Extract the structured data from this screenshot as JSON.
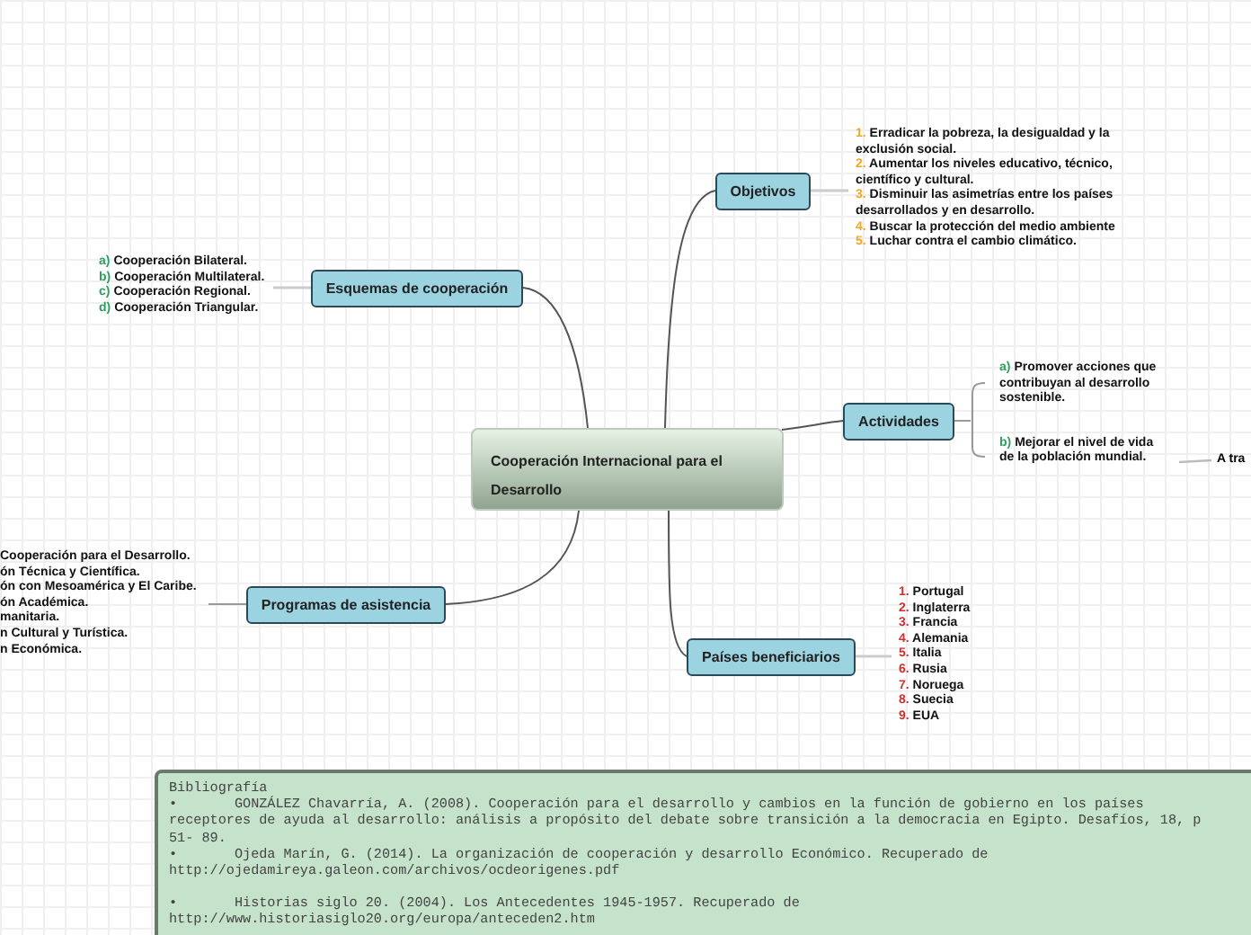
{
  "center": {
    "title": "Cooperación Internacional para el Desarrollo"
  },
  "branches": [
    {
      "label": "Objetivos",
      "color": "#f5a623",
      "items": [
        {
          "marker": "1.",
          "text": "Erradicar la pobreza, la desigualdad y la exclusión social."
        },
        {
          "marker": "2.",
          "text": "Aumentar los niveles educativo, técnico, científico y cultural."
        },
        {
          "marker": "3.",
          "text": "Disminuir las asimetrías entre los países desarrollados y en desarrollo."
        },
        {
          "marker": "4.",
          "text": "Buscar la protección del medio ambiente"
        },
        {
          "marker": "5.",
          "text": "Luchar contra el cambio climático."
        }
      ]
    },
    {
      "label": "Esquemas de cooperación",
      "color": "#2e9e5e",
      "items": [
        {
          "marker": "a)",
          "text": "Cooperación Bilateral."
        },
        {
          "marker": "b)",
          "text": "Cooperación Multilateral."
        },
        {
          "marker": "c)",
          "text": "Cooperación Regional."
        },
        {
          "marker": "d)",
          "text": "Cooperación Triangular."
        }
      ]
    },
    {
      "label": "Actividades",
      "color": "#2e9e5e",
      "items": [
        {
          "marker": "a)",
          "text": "Promover acciones que contribuyan al desarrollo sostenible."
        },
        {
          "marker": "b)",
          "text": "Mejorar el nivel de vida de la población mundial.",
          "children": [
            {
              "text": "A tra"
            }
          ]
        }
      ]
    },
    {
      "label": "Programas de asistencia",
      "items": [
        {
          "text": "Cooperación para el Desarrollo."
        },
        {
          "text": "ón Técnica y Científica."
        },
        {
          "text": "ón con Mesoamérica y El Caribe."
        },
        {
          "text": "ón Académica."
        },
        {
          "text": "manitaria."
        },
        {
          "text": "n Cultural y Turística."
        },
        {
          "text": "n Económica."
        }
      ]
    },
    {
      "label": "Países beneficiarios",
      "color": "#d0312d",
      "items": [
        {
          "marker": "1.",
          "text": "Portugal"
        },
        {
          "marker": "2.",
          "text": "Inglaterra"
        },
        {
          "marker": "3.",
          "text": "Francia"
        },
        {
          "marker": "4.",
          "text": "Alemania"
        },
        {
          "marker": "5.",
          "text": "Italia"
        },
        {
          "marker": "6.",
          "text": "Rusia"
        },
        {
          "marker": "7.",
          "text": "Noruega"
        },
        {
          "marker": "8.",
          "text": "Suecia"
        },
        {
          "marker": "9.",
          "text": "EUA"
        }
      ]
    }
  ],
  "bibliography": {
    "lines": [
      "Bibliografía",
      "•       GONZÁLEZ Chavarría, A. (2008). Cooperación para el desarrollo y cambios en la función de gobierno en los países",
      "receptores de ayuda al desarrollo: análisis a propósito del debate sobre transición a la democracia en Egipto. Desafíos, 18, p",
      "51- 89.",
      "•       Ojeda Marín, G. (2014). La organización de cooperación y desarrollo Económico. Recuperado de",
      "http://ojedamireya.galeon.com/archivos/ocdeorigenes.pdf",
      "•       Historias siglo 20. (2004). Los Antecedentes 1945-1957. Recuperado de",
      "http://www.historiasiglo20.org/europa/anteceden2.htm"
    ]
  }
}
